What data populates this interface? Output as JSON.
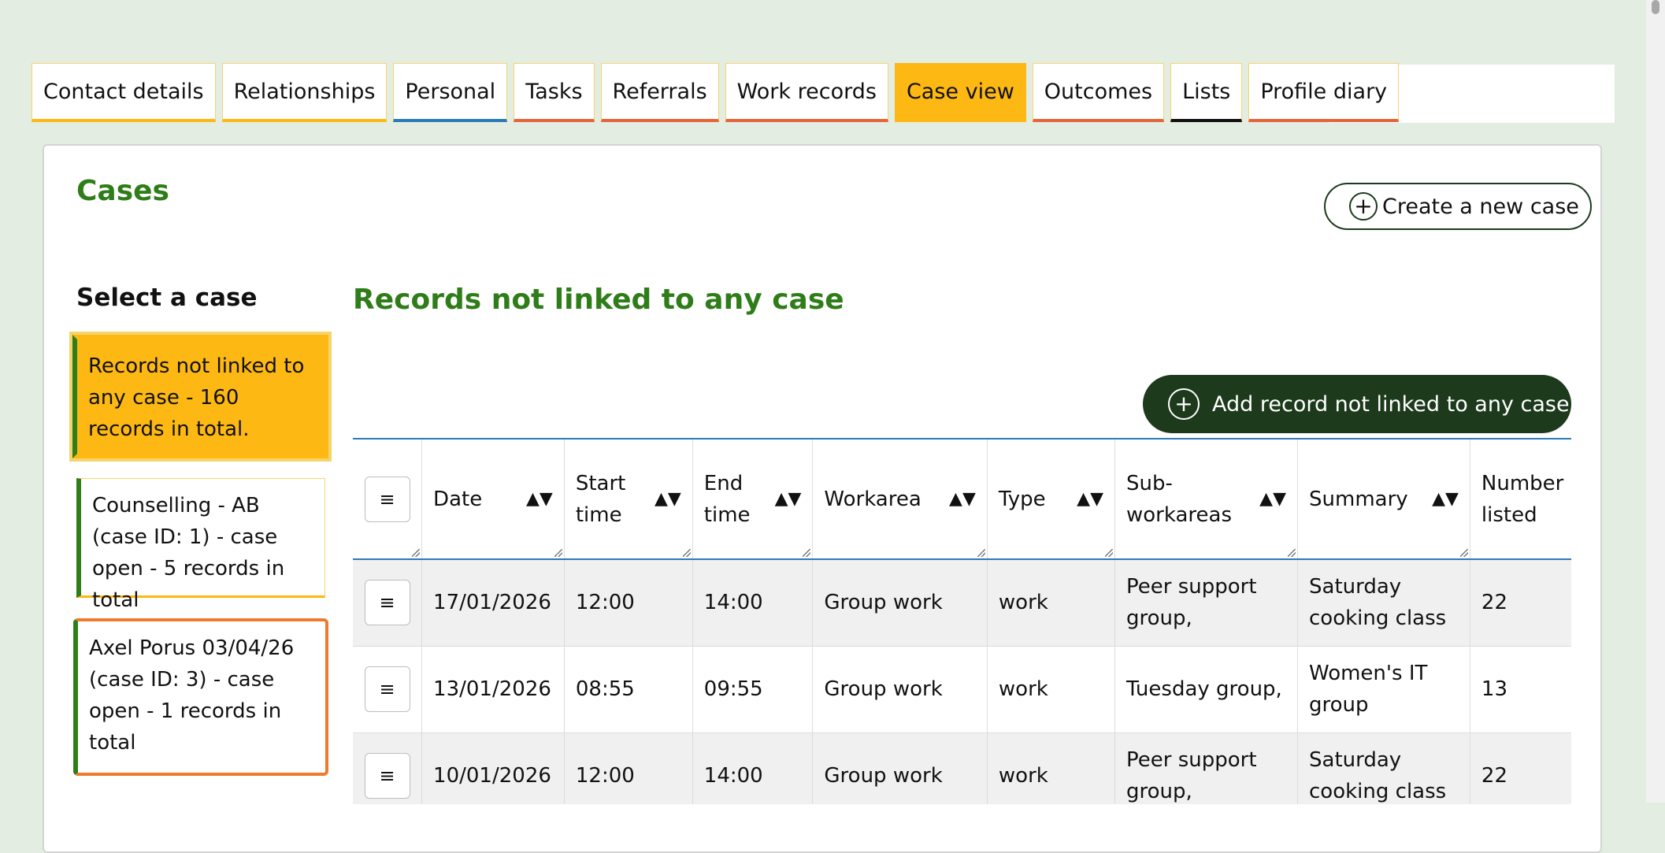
{
  "tabs": [
    {
      "label": "Contact details",
      "underline": "#fdb813",
      "active": false
    },
    {
      "label": "Relationships",
      "underline": "#fdb813",
      "active": false
    },
    {
      "label": "Personal",
      "underline": "#2a7ab8",
      "active": false
    },
    {
      "label": "Tasks",
      "underline": "#e5643a",
      "active": false
    },
    {
      "label": "Referrals",
      "underline": "#e5643a",
      "active": false
    },
    {
      "label": "Work records",
      "underline": "#e5643a",
      "active": false
    },
    {
      "label": "Case view",
      "underline": "#fdb813",
      "active": true
    },
    {
      "label": "Outcomes",
      "underline": "#e5643a",
      "active": false
    },
    {
      "label": "Lists",
      "underline": "#111111",
      "active": false
    },
    {
      "label": "Profile diary",
      "underline": "#e5643a",
      "active": false
    }
  ],
  "cases": {
    "title": "Cases",
    "create_button": "Create a new case",
    "select_title": "Select a case",
    "items": [
      {
        "label": "Records not linked to any case - 160 records in total.",
        "selected": true
      },
      {
        "label": "Counselling - AB (case ID: 1) - case open - 5 records in total",
        "selected": false
      },
      {
        "label": "Axel Porus 03/04/26 (case ID: 3) - case open - 1 records in total",
        "selected": false
      }
    ]
  },
  "records": {
    "title": "Records not linked to any case",
    "add_button": "Add record not linked to any case",
    "menu_glyph": "≡",
    "sort_glyph": "▲▼",
    "columns": [
      "Date",
      "Start time",
      "End time",
      "Workarea",
      "Type",
      "Sub-workareas",
      "Summary",
      "Number listed"
    ],
    "rows": [
      [
        "17/01/2026",
        "12:00",
        "14:00",
        "Group work",
        "work",
        "Peer support group,",
        "Saturday cooking class",
        "22"
      ],
      [
        "13/01/2026",
        "08:55",
        "09:55",
        "Group work",
        "work",
        "Tuesday group,",
        "Women's IT group",
        "13"
      ],
      [
        "10/01/2026",
        "12:00",
        "14:00",
        "Group work",
        "work",
        "Peer support group,",
        "Saturday cooking class",
        "22"
      ]
    ]
  },
  "colors": {
    "accent_green": "#2e7d19",
    "dark_green": "#1d3a1d",
    "selected_yellow": "#fdb813",
    "orange": "#ef7a2f",
    "blue": "#2a7ab8"
  }
}
